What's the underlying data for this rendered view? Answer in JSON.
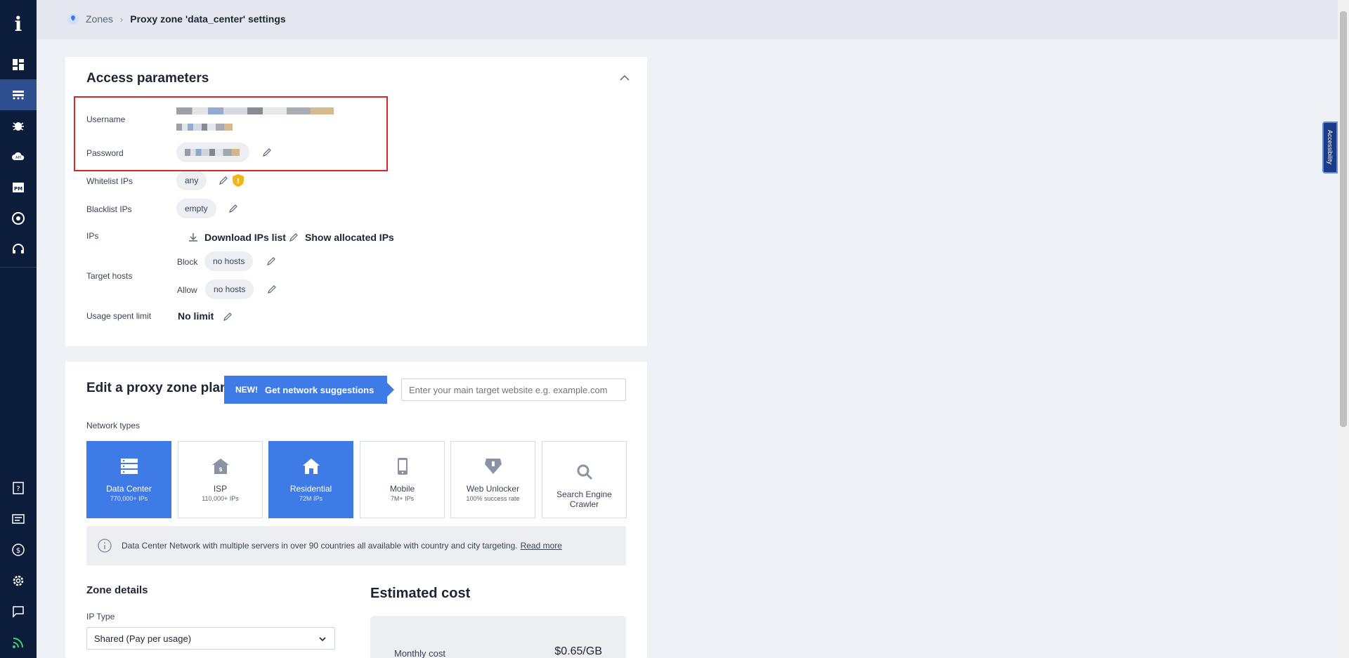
{
  "sidebar": {
    "logo": "i",
    "items": [
      {
        "name": "dashboard",
        "icon": "dashboard-icon"
      },
      {
        "name": "proxies",
        "icon": "proxy-network-icon",
        "active": true
      },
      {
        "name": "scraper",
        "icon": "bug-icon"
      },
      {
        "name": "api",
        "icon": "cloud-api-icon"
      },
      {
        "name": "proxy-manager",
        "icon": "pm-icon"
      },
      {
        "name": "browser",
        "icon": "chrome-icon"
      },
      {
        "name": "support",
        "icon": "headset-icon"
      }
    ],
    "bottom_items": [
      {
        "name": "help",
        "icon": "question-icon"
      },
      {
        "name": "tickets",
        "icon": "ticket-icon"
      },
      {
        "name": "billing",
        "icon": "dollar-icon"
      },
      {
        "name": "settings",
        "icon": "gear-icon"
      },
      {
        "name": "chat",
        "icon": "chat-icon"
      },
      {
        "name": "feed",
        "icon": "rss-icon"
      }
    ]
  },
  "breadcrumb": {
    "root": "Zones",
    "current": "Proxy zone 'data_center' settings"
  },
  "accessibility_tab": "Accessibility",
  "access": {
    "title": "Access parameters",
    "username_label": "Username",
    "password_label": "Password",
    "whitelist_label": "Whitelist IPs",
    "whitelist_value": "any",
    "blacklist_label": "Blacklist IPs",
    "blacklist_value": "empty",
    "ips_label": "IPs",
    "download_ips": "Download IPs list",
    "show_allocated": "Show allocated IPs",
    "target_hosts_label": "Target hosts",
    "block_label": "Block",
    "block_value": "no hosts",
    "allow_label": "Allow",
    "allow_value": "no hosts",
    "usage_label": "Usage spent limit",
    "usage_value": "No limit"
  },
  "plan": {
    "title": "Edit a proxy zone plan",
    "new_tag": "NEW!",
    "suggest_button": "Get network suggestions",
    "target_placeholder": "Enter your main target website e.g. example.com",
    "network_types_label": "Network types",
    "tiles": [
      {
        "name": "Data Center",
        "sub": "770,000+ IPs",
        "icon": "server-icon",
        "active": true
      },
      {
        "name": "ISP",
        "sub": "110,000+ IPs",
        "icon": "isp-house-icon",
        "active": false
      },
      {
        "name": "Residential",
        "sub": "72M IPs",
        "icon": "house-icon",
        "active": true
      },
      {
        "name": "Mobile",
        "sub": "7M+ IPs",
        "icon": "mobile-icon",
        "active": false
      },
      {
        "name": "Web Unlocker",
        "sub": "100% success rate",
        "icon": "unlocker-icon",
        "active": false
      },
      {
        "name": "Search Engine Crawler",
        "sub": "",
        "icon": "magnifier-icon",
        "active": false
      }
    ],
    "info_text": "Data Center Network with multiple servers in over 90 countries all available with country and city targeting.",
    "info_link": "Read more",
    "zone_details_title": "Zone details",
    "ip_type_label": "IP Type",
    "ip_type_value": "Shared (Pay per usage)",
    "estimated_cost_title": "Estimated cost",
    "monthly_cost_label": "Monthly cost",
    "monthly_cost_value": "$0.65/GB"
  },
  "colors": {
    "sidebar_bg": "#0c1d3b",
    "accent": "#3f7be6",
    "highlight_box": "#d9262c",
    "warning": "#f2b619"
  }
}
